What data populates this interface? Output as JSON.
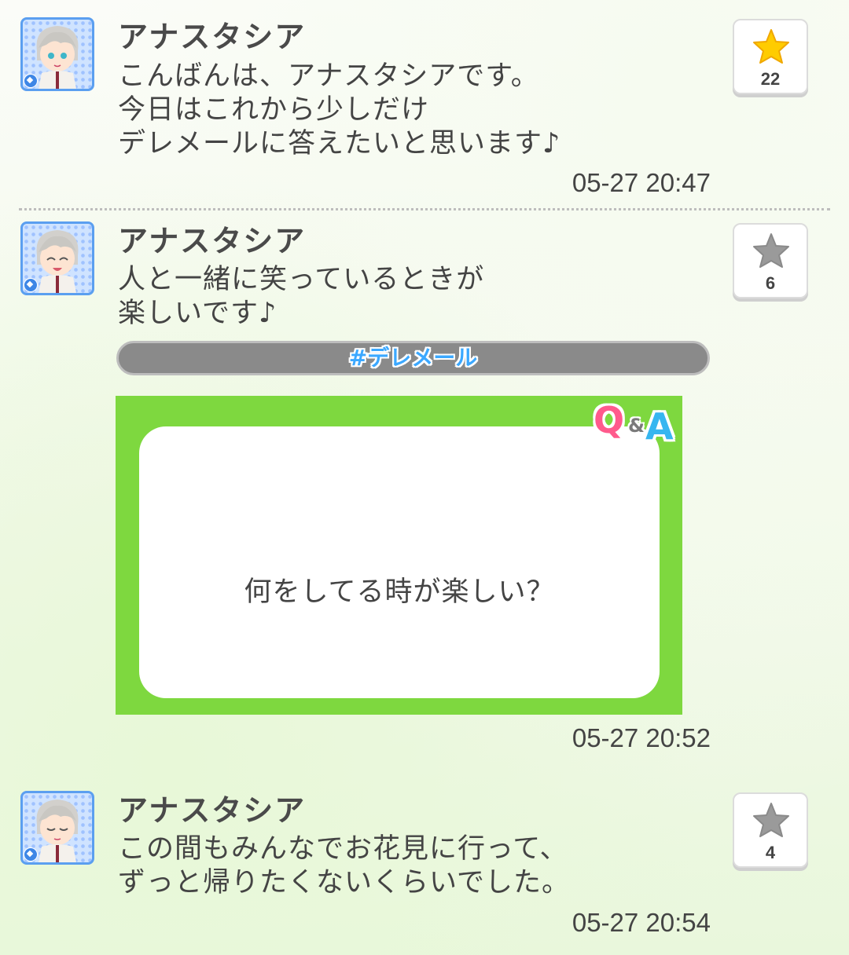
{
  "colors": {
    "avatar_border": "#5b9ff0",
    "qa_card_bg": "#7ed83f",
    "hashtag_bar_bg": "#8a8a8a",
    "hashtag_text": "#3ba8ff",
    "star_active": "#ffcc00",
    "star_inactive": "#9a9a9a"
  },
  "posts": [
    {
      "author": "アナスタシア",
      "avatar_icon": "character-avatar-icon",
      "lines": [
        "こんばんは、アナスタシアです。",
        "今日はこれから少しだけ",
        "デレメールに答えたいと思います♪"
      ],
      "timestamp": "05-27 20:47",
      "star_count": "22",
      "star_active": true
    },
    {
      "author": "アナスタシア",
      "avatar_icon": "character-avatar-smiling-icon",
      "lines": [
        "人と一緒に笑っているときが",
        "楽しいです♪"
      ],
      "hashtag": "#デレメール",
      "qa_logo": {
        "q": "Q",
        "amp": "&",
        "a": "A"
      },
      "qa_question": "何をしてる時が楽しい？",
      "timestamp": "05-27 20:52",
      "star_count": "6",
      "star_active": false
    },
    {
      "author": "アナスタシア",
      "avatar_icon": "character-avatar-eyes-closed-icon",
      "lines": [
        "この間もみんなでお花見に行って、",
        "ずっと帰りたくないくらいでした。"
      ],
      "timestamp": "05-27 20:54",
      "star_count": "4",
      "star_active": false
    }
  ]
}
